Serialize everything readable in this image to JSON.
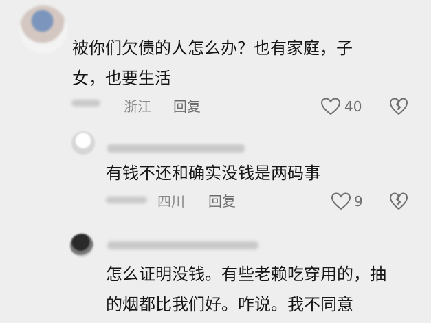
{
  "comments": [
    {
      "text": "被你们欠债的人怎么办？也有家庭，子\n女，也要生活",
      "location": "浙江",
      "reply_label": "回复",
      "likes": "40"
    },
    {
      "text": "有钱不还和确实没钱是两码事",
      "location": "四川",
      "reply_label": "回复",
      "likes": "9"
    },
    {
      "text": "怎么证明没钱。有些老赖吃穿用的，抽\n的烟都比我们好。咋说。我不同意",
      "location": "",
      "reply_label": "",
      "likes": ""
    }
  ],
  "icons": {
    "like": "heart-outline-icon",
    "dislike": "broken-heart-icon"
  },
  "colors": {
    "background": "#eeeeee",
    "text": "#161616",
    "meta": "#8a8a8a",
    "icon": "#6f6f6f"
  }
}
